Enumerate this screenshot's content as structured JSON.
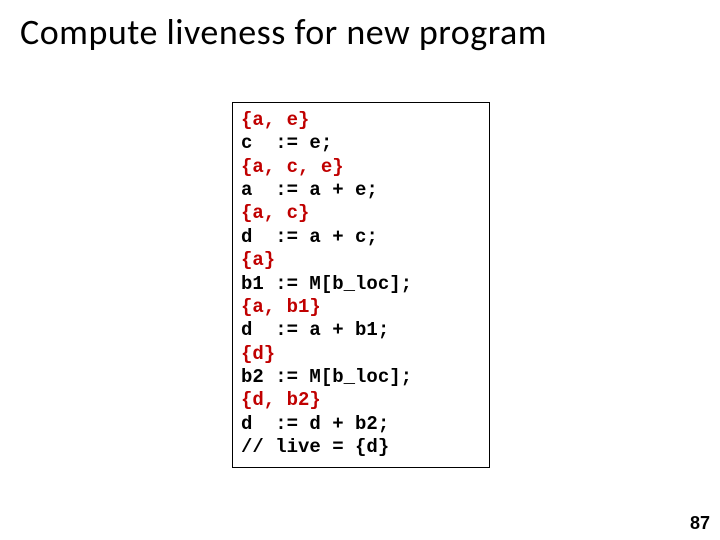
{
  "title": "Compute liveness for new program",
  "code": {
    "l1": "{a, e}",
    "l2": "c  := e;",
    "l3": "{a, c, e}",
    "l4": "a  := a + e;",
    "l5": "{a, c}",
    "l6": "d  := a + c;",
    "l7": "{a}",
    "l8": "b1 := M[b_loc];",
    "l9": "{a, b1}",
    "l10": "d  := a + b1;",
    "l11": "{d}",
    "l12": "b2 := M[b_loc];",
    "l13": "{d, b2}",
    "l14": "d  := d + b2;",
    "l15": "// live = {d}"
  },
  "page_number": "87"
}
